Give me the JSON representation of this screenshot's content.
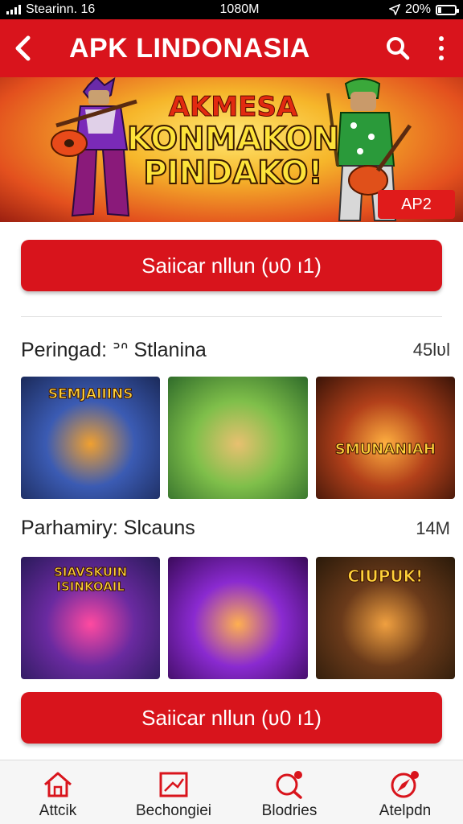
{
  "status_bar": {
    "carrier": "Stearinn. 16",
    "time": "1080M",
    "battery": "20%",
    "battery_level": 0.2
  },
  "app_bar": {
    "title": "APK LINDONASIA"
  },
  "banner": {
    "line1": "AKMESA",
    "line2": "KONMAKON",
    "line3": "PINDAKO!",
    "badge": "AP2"
  },
  "buttons": {
    "top_label": "Saiicar nllun (ʋ0 ı1)",
    "bottom_label": "Saiicar nllun (ʋ0 ı1)"
  },
  "sections": [
    {
      "title": "Peringad: ᐣᐢ Stlanina",
      "count": "45lʋl",
      "thumbs": [
        {
          "label": "SEMJAIIINS",
          "colors": [
            "#1b2a5a",
            "#3b5bb3",
            "#f0a030"
          ]
        },
        {
          "label": "",
          "colors": [
            "#2f6b2a",
            "#7fbf4a",
            "#e8c070"
          ]
        },
        {
          "label": "SMUNANIAH",
          "colors": [
            "#3a1408",
            "#b2401a",
            "#ffb040"
          ]
        }
      ]
    },
    {
      "title": "Parhamiry: Slcauns",
      "count": "14M",
      "thumbs": [
        {
          "label": "SIAVSKUIN ISINKOAIL",
          "colors": [
            "#2a1a5a",
            "#6a2aa0",
            "#ff4aa0"
          ]
        },
        {
          "label": "",
          "colors": [
            "#3a0a5a",
            "#8a2ad0",
            "#ffb050"
          ]
        },
        {
          "label": "CIUPUK!",
          "colors": [
            "#2a1a0a",
            "#6a3a1a",
            "#f0a040"
          ]
        }
      ]
    }
  ],
  "bottom_nav": [
    {
      "label": "Attcik",
      "icon": "home-icon"
    },
    {
      "label": "Bechongiei",
      "icon": "chart-icon"
    },
    {
      "label": "Blodries",
      "icon": "search-icon"
    },
    {
      "label": "Atelpdn",
      "icon": "compass-icon"
    }
  ],
  "colors": {
    "brand_red": "#d9141c",
    "nav_bg": "#f6f6f6"
  }
}
